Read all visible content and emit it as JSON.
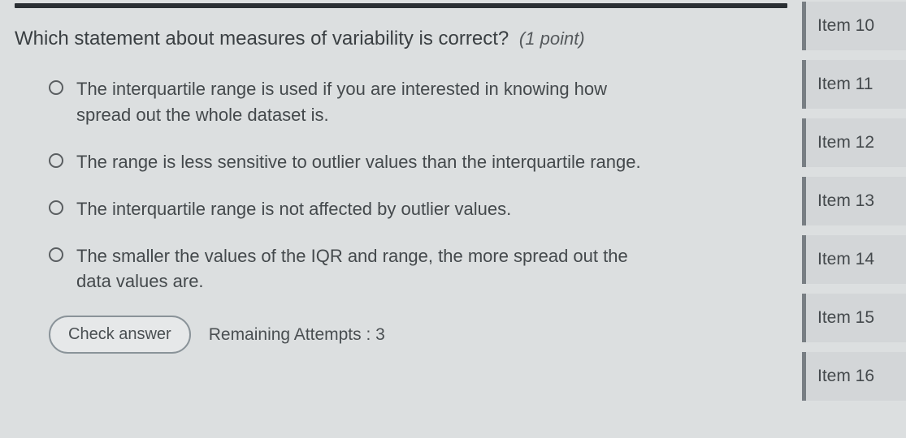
{
  "question": {
    "text": "Which statement about measures of variability is correct?",
    "points_label": "(1 point)"
  },
  "options": [
    {
      "text": "The interquartile range is used if you are interested in knowing how spread out the whole dataset is."
    },
    {
      "text": "The range is less sensitive to outlier values than the interquartile range."
    },
    {
      "text": "The interquartile range is not affected by outlier values."
    },
    {
      "text": "The smaller the values of the IQR and range, the more spread out the data values are."
    }
  ],
  "footer": {
    "check_label": "Check answer",
    "attempts_label": "Remaining Attempts : 3"
  },
  "sidebar": {
    "items": [
      {
        "label": "Item 10"
      },
      {
        "label": "Item 11"
      },
      {
        "label": "Item 12"
      },
      {
        "label": "Item 13"
      },
      {
        "label": "Item 14"
      },
      {
        "label": "Item 15"
      },
      {
        "label": "Item 16"
      }
    ]
  }
}
